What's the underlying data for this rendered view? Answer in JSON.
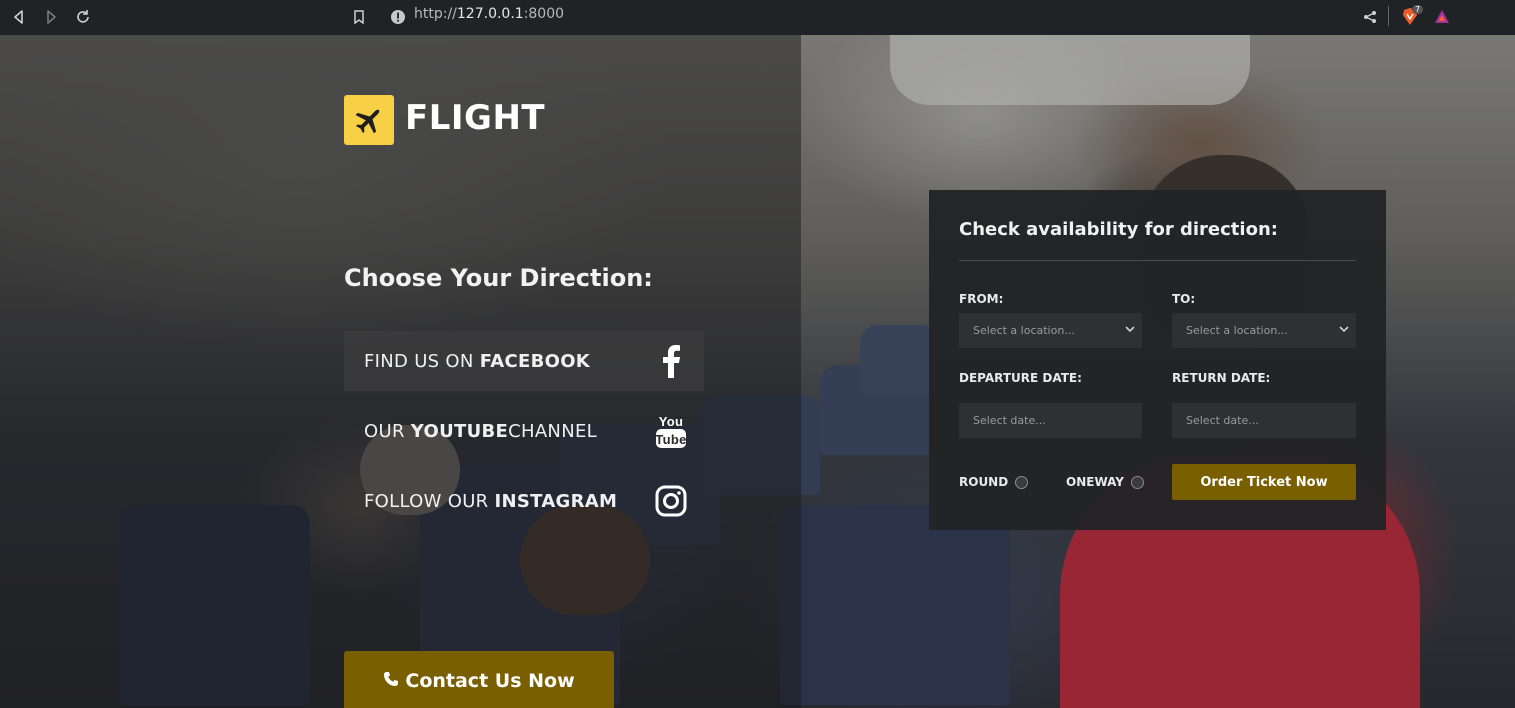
{
  "browser": {
    "url_scheme": "http://",
    "url_host": "127.0.0.1",
    "url_port": ":8000",
    "shields_count": "7"
  },
  "brand": {
    "name": "FLIGHT",
    "logo_color": "#f7d046"
  },
  "left": {
    "heading": "Choose Your Direction:",
    "social": [
      {
        "prefix": "FIND US ON ",
        "bold": "FACEBOOK",
        "suffix": "",
        "icon": "facebook-icon"
      },
      {
        "prefix": "OUR ",
        "bold": "YOUTUBE",
        "suffix": " CHANNEL",
        "icon": "youtube-icon"
      },
      {
        "prefix": "FOLLOW OUR ",
        "bold": "INSTAGRAM",
        "suffix": "",
        "icon": "instagram-icon"
      }
    ],
    "contact_label": "Contact Us Now",
    "accent_color": "#7a5f00"
  },
  "booking": {
    "title": "Check availability for direction:",
    "from_label": "FROM:",
    "to_label": "TO:",
    "from_placeholder": "Select a location...",
    "to_placeholder": "Select a location...",
    "departure_label": "DEPARTURE DATE:",
    "return_label": "RETURN DATE:",
    "departure_placeholder": "Select date...",
    "return_placeholder": "Select date...",
    "round_label": "ROUND",
    "oneway_label": "ONEWAY",
    "order_label": "Order Ticket Now"
  }
}
